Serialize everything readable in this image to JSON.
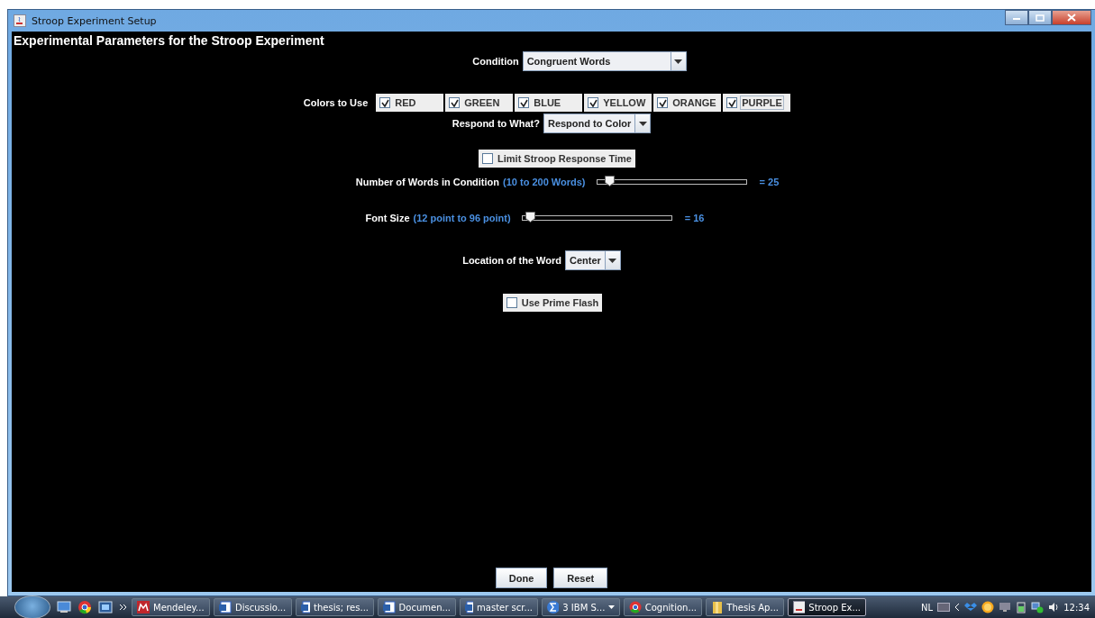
{
  "window": {
    "title": "Stroop Experiment Setup"
  },
  "heading": "Experimental Parameters for the Stroop Experiment",
  "condition": {
    "label": "Condition",
    "value": "Congruent Words"
  },
  "colors": {
    "label": "Colors to Use",
    "options": [
      {
        "label": "RED",
        "checked": true,
        "selected": false
      },
      {
        "label": "GREEN",
        "checked": true,
        "selected": false
      },
      {
        "label": "BLUE",
        "checked": true,
        "selected": false
      },
      {
        "label": "YELLOW",
        "checked": true,
        "selected": false
      },
      {
        "label": "ORANGE",
        "checked": true,
        "selected": false
      },
      {
        "label": "PURPLE",
        "checked": true,
        "selected": true
      }
    ]
  },
  "respond": {
    "label": "Respond to What?",
    "value": "Respond to Color"
  },
  "limit_time": {
    "label": "Limit Stroop Response Time",
    "checked": false
  },
  "sliders": [
    {
      "label": "Number of Words in Condition",
      "range": "(10 to 200 Words)",
      "level": 0.08,
      "reading": "= 25"
    },
    {
      "label": "Font Size",
      "range": "(12 point to 96 point)",
      "level": 0.05,
      "reading": "= 16"
    }
  ],
  "location": {
    "label": "Location of the Word",
    "value": "Center"
  },
  "prime_flash": {
    "label": "Use Prime Flash",
    "checked": false
  },
  "buttons": [
    "Done",
    "Reset"
  ],
  "taskbar": {
    "items": [
      {
        "label": "Mendeley...",
        "kind": "mendeley",
        "selected": false
      },
      {
        "label": "Discussio...",
        "kind": "doc",
        "selected": false
      },
      {
        "label": "thesis; res...",
        "kind": "doc",
        "selected": false
      },
      {
        "label": "Documen...",
        "kind": "doc",
        "selected": false
      },
      {
        "label": "master scr...",
        "kind": "doc",
        "selected": false
      },
      {
        "label": "3 IBM S...",
        "kind": "group",
        "selected": false
      },
      {
        "label": "Cognition...",
        "kind": "browser",
        "selected": false
      },
      {
        "label": "Thesis Ap...",
        "kind": "folder",
        "selected": false
      },
      {
        "label": "Stroop Ex...",
        "kind": "java",
        "selected": true
      }
    ],
    "language": "NL",
    "time": "12:34"
  }
}
